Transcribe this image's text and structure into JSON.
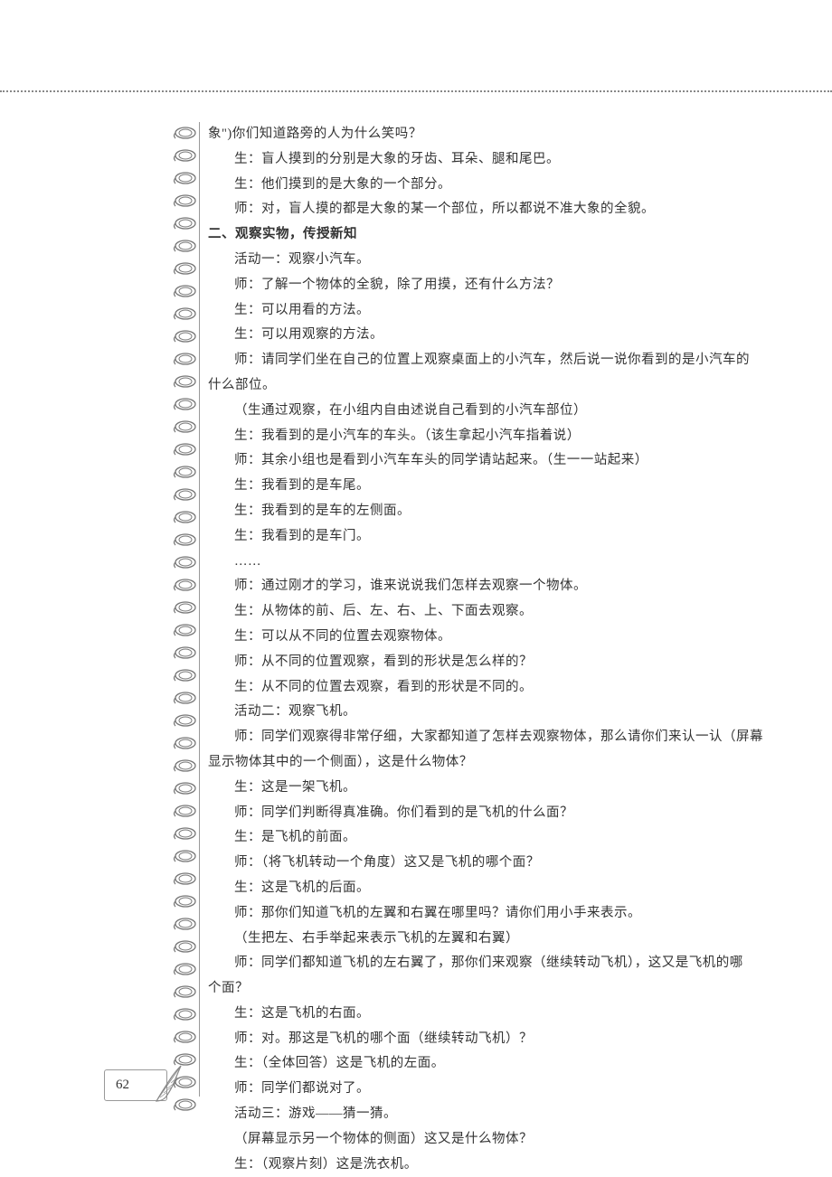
{
  "page_number": "62",
  "lines": [
    {
      "cls": "fragment-start",
      "text": "象\")你们知道路旁的人为什么笑吗？"
    },
    {
      "cls": "para",
      "text": "生：盲人摸到的分别是大象的牙齿、耳朵、腿和尾巴。"
    },
    {
      "cls": "para",
      "text": "生：他们摸到的是大象的一个部分。"
    },
    {
      "cls": "para",
      "text": "师：对，盲人摸的都是大象的某一个部位，所以都说不准大象的全貌。"
    },
    {
      "cls": "heading",
      "text": "二、观察实物，传授新知"
    },
    {
      "cls": "para",
      "text": "活动一：观察小汽车。"
    },
    {
      "cls": "para",
      "text": "师：了解一个物体的全貌，除了用摸，还有什么方法？"
    },
    {
      "cls": "para",
      "text": "生：可以用看的方法。"
    },
    {
      "cls": "para",
      "text": "生：可以用观察的方法。"
    },
    {
      "cls": "para",
      "text": "师：请同学们坐在自己的位置上观察桌面上的小汽车，然后说一说你看到的是小汽车的"
    },
    {
      "cls": "para-noindent",
      "text": "什么部位。"
    },
    {
      "cls": "para",
      "text": "（生通过观察，在小组内自由述说自己看到的小汽车部位）"
    },
    {
      "cls": "para",
      "text": "生：我看到的是小汽车的车头。（该生拿起小汽车指着说）"
    },
    {
      "cls": "para",
      "text": "师：其余小组也是看到小汽车车头的同学请站起来。（生一一站起来）"
    },
    {
      "cls": "para",
      "text": "生：我看到的是车尾。"
    },
    {
      "cls": "para",
      "text": "生：我看到的是车的左侧面。"
    },
    {
      "cls": "para",
      "text": "生：我看到的是车门。"
    },
    {
      "cls": "para",
      "text": "……"
    },
    {
      "cls": "para",
      "text": "师：通过刚才的学习，谁来说说我们怎样去观察一个物体。"
    },
    {
      "cls": "para",
      "text": "生：从物体的前、后、左、右、上、下面去观察。"
    },
    {
      "cls": "para",
      "text": "生：可以从不同的位置去观察物体。"
    },
    {
      "cls": "para",
      "text": "师：从不同的位置观察，看到的形状是怎么样的？"
    },
    {
      "cls": "para",
      "text": "生：从不同的位置去观察，看到的形状是不同的。"
    },
    {
      "cls": "para",
      "text": "活动二：观察飞机。"
    },
    {
      "cls": "para",
      "text": "师：同学们观察得非常仔细，大家都知道了怎样去观察物体，那么请你们来认一认（屏幕"
    },
    {
      "cls": "para-noindent",
      "text": "显示物体其中的一个侧面），这是什么物体？"
    },
    {
      "cls": "para",
      "text": "生：这是一架飞机。"
    },
    {
      "cls": "para",
      "text": "师：同学们判断得真准确。你们看到的是飞机的什么面？"
    },
    {
      "cls": "para",
      "text": "生：是飞机的前面。"
    },
    {
      "cls": "para",
      "text": "师：（将飞机转动一个角度）这又是飞机的哪个面？"
    },
    {
      "cls": "para",
      "text": "生：这是飞机的后面。"
    },
    {
      "cls": "para",
      "text": "师：那你们知道飞机的左翼和右翼在哪里吗？请你们用小手来表示。"
    },
    {
      "cls": "para",
      "text": "（生把左、右手举起来表示飞机的左翼和右翼）"
    },
    {
      "cls": "para",
      "text": "师：同学们都知道飞机的左右翼了，那你们来观察（继续转动飞机），这又是飞机的哪"
    },
    {
      "cls": "para-noindent",
      "text": "个面？"
    },
    {
      "cls": "para",
      "text": "生：这是飞机的右面。"
    },
    {
      "cls": "para",
      "text": "师：对。那这是飞机的哪个面（继续转动飞机）？"
    },
    {
      "cls": "para",
      "text": "生：（全体回答）这是飞机的左面。"
    },
    {
      "cls": "para",
      "text": "师：同学们都说对了。"
    },
    {
      "cls": "para",
      "text": "活动三：游戏——猜一猜。"
    },
    {
      "cls": "para",
      "text": "（屏幕显示另一个物体的侧面）这又是什么物体？"
    },
    {
      "cls": "para",
      "text": "生：（观察片刻）这是洗衣机。"
    }
  ]
}
